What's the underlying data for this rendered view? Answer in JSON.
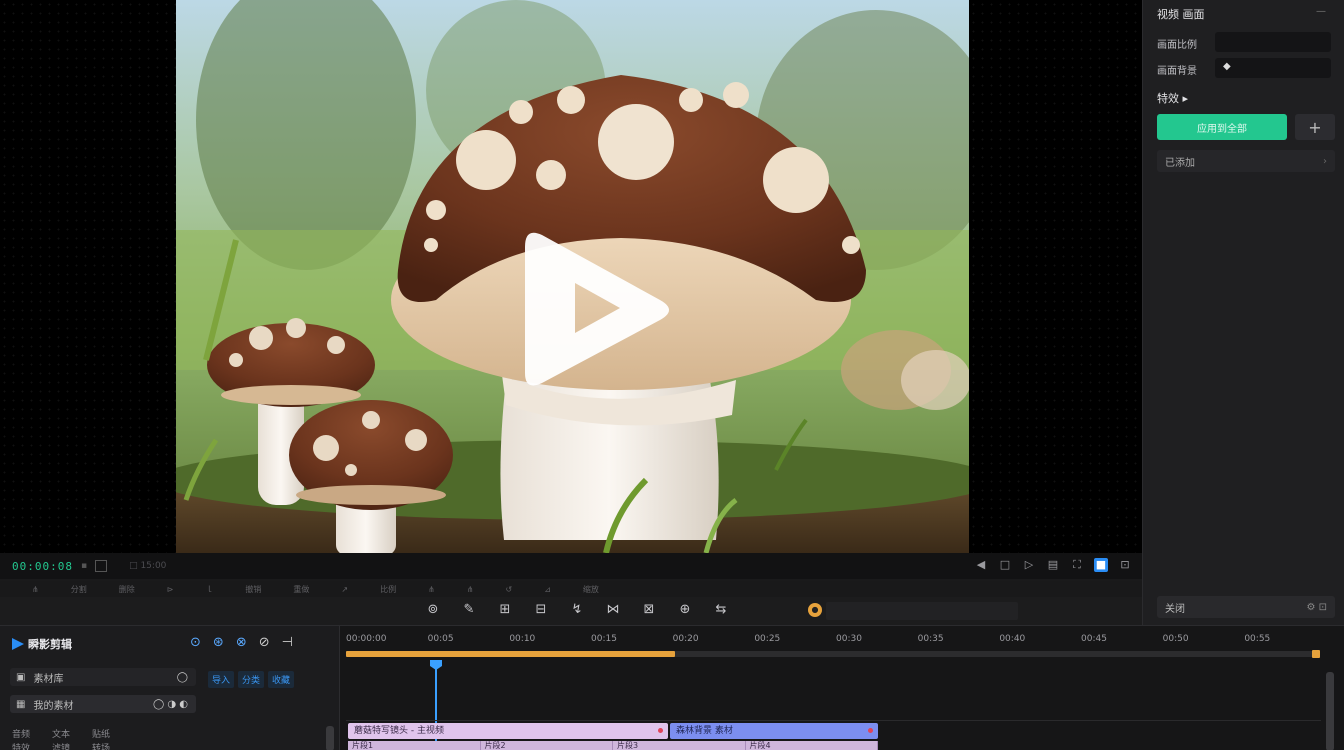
{
  "app": {
    "brand": "瞬影剪辑",
    "timecode": "00:00:08"
  },
  "side_panel": {
    "title": "视频 画面",
    "collapse": "—",
    "field1_label": "画面比例",
    "field2_label": "画面背景",
    "section2_title": "特效 ▸",
    "apply_button": "应用到全部",
    "add_button": "+",
    "list_item": "已添加",
    "bottom_label": "关闭"
  },
  "player_bar": {
    "sep1": "▪",
    "dim1": "□ 15:00",
    "right_icons": [
      "◀",
      "□",
      "▷",
      "▤",
      "⛶",
      "■",
      "⊡"
    ]
  },
  "toolbar": {
    "row1": [
      "⋔",
      "分割",
      "删除",
      "⊳",
      "ｌ",
      "撤销",
      "重做",
      "↗",
      "比例",
      "⋔",
      "⋔",
      "↺",
      "⊿",
      "缩放"
    ],
    "tools": [
      "⊚",
      "✎",
      "⊞",
      "⊟",
      "↯",
      "⋈",
      "⊠",
      "⊕",
      "⇆"
    ],
    "record_icon": "●"
  },
  "media_panel": {
    "icons": [
      "⊙",
      "⊛",
      "⊗",
      "⊘",
      "⊣"
    ],
    "row1_label": "素材库",
    "row1_end": "◯",
    "row2_label": "我的素材",
    "row2_icons": [
      "◯",
      "◑",
      "◐"
    ],
    "tabs": [
      "导入",
      "分类",
      "收藏"
    ],
    "line1": [
      "音频",
      "文本",
      "贴纸"
    ],
    "line2": [
      "特效",
      "滤镜",
      "转场"
    ]
  },
  "timeline": {
    "ruler": [
      "00:00:00",
      "00:05",
      "00:10",
      "00:15",
      "00:20",
      "00:25",
      "00:30",
      "00:35",
      "00:40",
      "00:45",
      "00:50",
      "00:55"
    ],
    "progress": 0.34,
    "clip_a_label": "蘑菇特写镜头 - 主视频",
    "clip_b_label": "森林背景 素材",
    "clip_row2": [
      "片段1",
      "片段2",
      "片段3",
      "片段4"
    ]
  }
}
